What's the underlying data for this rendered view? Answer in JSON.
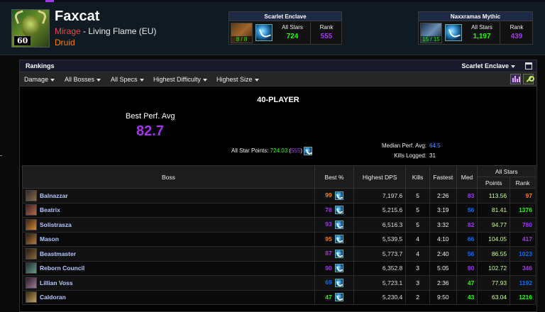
{
  "character": {
    "name": "Faxcat",
    "realm": "Mirage",
    "realm_separator": " - ",
    "server": "Living Flame (EU)",
    "class": "Druid",
    "level": "60",
    "class_color": "#ff7d0a"
  },
  "zones": [
    {
      "title": "Scarlet Enclave",
      "progress": "8 / 8",
      "all_stars_label": "All Stars",
      "all_stars": "724",
      "rank_label": "Rank",
      "rank": "555"
    },
    {
      "title": "Naxxramas Mythic",
      "progress": "15 / 15",
      "all_stars_label": "All Stars",
      "all_stars": "1,197",
      "rank_label": "Rank",
      "rank": "439"
    }
  ],
  "panel": {
    "title": "Rankings",
    "zone_select": "Scarlet Enclave"
  },
  "filters": [
    "Damage",
    "All Bosses",
    "All Specs",
    "Highest Difficulty",
    "Highest Size"
  ],
  "summary": {
    "mode": "40-PLAYER",
    "best_perf_label": "Best Perf. Avg",
    "best_perf_value": "82.7",
    "median_label": "Median Perf. Avg:",
    "median_value": "64.5",
    "kills_label": "Kills Logged:",
    "kills_value": "31",
    "allstar_label": "All Star Points:",
    "allstar_points": "724.03",
    "allstar_rank": "555"
  },
  "table": {
    "headers": {
      "boss": "Boss",
      "best": "Best %",
      "dps": "Highest DPS",
      "kills": "Kills",
      "fastest": "Fastest",
      "med": "Med",
      "allstars": "All Stars",
      "points": "Points",
      "rank": "Rank"
    },
    "rows": [
      {
        "boss": "Balnazzar",
        "best": "99",
        "dps": "7,197.6",
        "kills": "5",
        "fastest": "2:26",
        "med": "83",
        "points": "113.56",
        "rank": "97"
      },
      {
        "boss": "Beatrix",
        "best": "78",
        "dps": "5,215.6",
        "kills": "5",
        "fastest": "3:19",
        "med": "56",
        "points": "81.41",
        "rank": "1376"
      },
      {
        "boss": "Solistrasza",
        "best": "93",
        "dps": "6,516.3",
        "kills": "5",
        "fastest": "3:32",
        "med": "82",
        "points": "94.77",
        "rank": "780"
      },
      {
        "boss": "Mason",
        "best": "95",
        "dps": "5,539.5",
        "kills": "4",
        "fastest": "4:10",
        "med": "66",
        "points": "104.05",
        "rank": "417"
      },
      {
        "boss": "Beastmaster",
        "best": "87",
        "dps": "5,773.7",
        "kills": "4",
        "fastest": "2:40",
        "med": "56",
        "points": "86.55",
        "rank": "1023"
      },
      {
        "boss": "Reborn Council",
        "best": "90",
        "dps": "6,352.8",
        "kills": "3",
        "fastest": "5:05",
        "med": "80",
        "points": "102.72",
        "rank": "346"
      },
      {
        "boss": "Lillian Voss",
        "best": "69",
        "dps": "5,723.1",
        "kills": "3",
        "fastest": "2:36",
        "med": "47",
        "points": "77.93",
        "rank": "1192"
      },
      {
        "boss": "Caldoran",
        "best": "47",
        "dps": "5,230.4",
        "kills": "2",
        "fastest": "9:50",
        "med": "43",
        "points": "63.04",
        "rank": "1216"
      }
    ]
  }
}
